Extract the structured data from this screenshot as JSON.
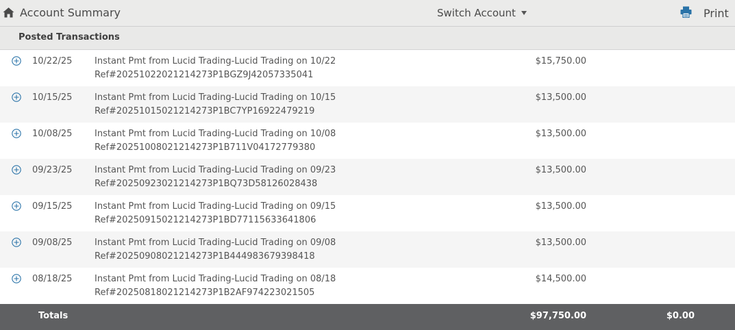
{
  "header": {
    "title": "Account Summary",
    "switch_account_label": "Switch Account",
    "print_label": "Print",
    "icons": {
      "home": "home-icon",
      "switch_caret": "caret-down-icon",
      "print": "printer-icon"
    },
    "print_icon_color": "#2a73a8"
  },
  "section": {
    "title": "Posted Transactions"
  },
  "transactions": [
    {
      "date": "10/22/25",
      "description": "Instant Pmt from Lucid Trading-Lucid Trading on 10/22",
      "reference": "Ref#20251022021214273P1BGZ9J42057335041",
      "amount": "$15,750.00"
    },
    {
      "date": "10/15/25",
      "description": "Instant Pmt from Lucid Trading-Lucid Trading on 10/15",
      "reference": "Ref#20251015021214273P1BC7YP16922479219",
      "amount": "$13,500.00"
    },
    {
      "date": "10/08/25",
      "description": "Instant Pmt from Lucid Trading-Lucid Trading on 10/08",
      "reference": "Ref#20251008021214273P1B711V04172779380",
      "amount": "$13,500.00"
    },
    {
      "date": "09/23/25",
      "description": "Instant Pmt from Lucid Trading-Lucid Trading on 09/23",
      "reference": "Ref#20250923021214273P1BQ73D58126028438",
      "amount": "$13,500.00"
    },
    {
      "date": "09/15/25",
      "description": "Instant Pmt from Lucid Trading-Lucid Trading on 09/15",
      "reference": "Ref#20250915021214273P1BD77115633641806",
      "amount": "$13,500.00"
    },
    {
      "date": "09/08/25",
      "description": "Instant Pmt from Lucid Trading-Lucid Trading on 09/08",
      "reference": "Ref#20250908021214273P1B444983679398418",
      "amount": "$13,500.00"
    },
    {
      "date": "08/18/25",
      "description": "Instant Pmt from Lucid Trading-Lucid Trading on 08/18",
      "reference": "Ref#20250818021214273P1B2AF974223021505",
      "amount": "$14,500.00"
    }
  ],
  "row_icon": "plus-circle-icon",
  "row_icon_color": "#2a73a8",
  "totals": {
    "label": "Totals",
    "credits": "$97,750.00",
    "debits": "$0.00"
  }
}
